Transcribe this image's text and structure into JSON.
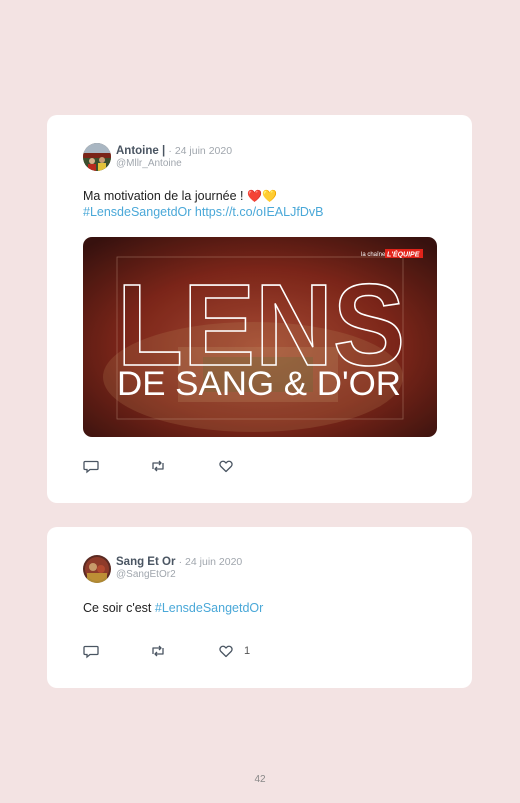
{
  "tweets": [
    {
      "author": "Antoine |",
      "date": "· 24 juin 2020",
      "handle": "@Mllr_Antoine",
      "text": "Ma motivation de la journée !",
      "hearts": "❤️💛",
      "hashtag": "#LensdeSangetdOr",
      "url": "https://t.co/oIEALJfDvB",
      "media": {
        "title": "LENS",
        "subtitle": "DE SANG & D'OR",
        "brand_small": "la chaîne",
        "brand": "L'ÉQUIPE"
      },
      "like_count": ""
    },
    {
      "author": "Sang Et Or",
      "date": "· 24 juin 2020",
      "handle": "@SangEtOr2",
      "text": "Ce soir c'est",
      "hashtag": "#LensdeSangetdOr",
      "like_count": "1"
    }
  ],
  "page_number": "42",
  "colors": {
    "page_bg": "#f3e3e3",
    "card_bg": "#ffffff",
    "link": "#4aa8d8",
    "media_red": "#9a2a1c",
    "brand_red": "#e2231a"
  },
  "icons": [
    "reply-icon",
    "retweet-icon",
    "like-icon"
  ]
}
